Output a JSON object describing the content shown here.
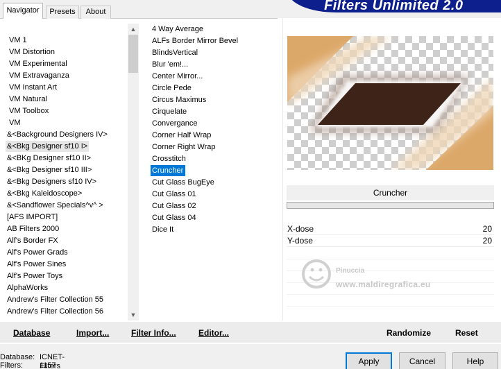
{
  "title": "Filters Unlimited 2.0",
  "tabs": [
    "Navigator",
    "Presets",
    "About"
  ],
  "categories": [
    "VM 1",
    "VM Distortion",
    "VM Experimental",
    "VM Extravaganza",
    "VM Instant Art",
    "VM Natural",
    "VM Toolbox",
    "VM",
    "&<Background Designers IV>",
    "&<Bkg Designer sf10 I>",
    "&<BKg Designer sf10 II>",
    "&<Bkg Designer sf10 III>",
    "&<Bkg Designers sf10 IV>",
    "&<Bkg Kaleidoscope>",
    "&<Sandflower Specials^v^ >",
    "[AFS IMPORT]",
    "AB Filters 2000",
    "Alf's Border FX",
    "Alf's Power Grads",
    "Alf's Power Sines",
    "Alf's Power Toys",
    "AlphaWorks",
    "Andrew's Filter Collection 55",
    "Andrew's Filter Collection 56"
  ],
  "filters": [
    "4 Way Average",
    "ALFs Border Mirror Bevel",
    "BlindsVertical",
    "Blur 'em!...",
    "Center Mirror...",
    "Circle Pede",
    "Circus Maximus",
    "Cirquelate",
    "Convergance",
    "Corner Half Wrap",
    "Corner Right Wrap",
    "Crosstitch",
    "Cruncher",
    "Cut Glass  BugEye",
    "Cut Glass 01",
    "Cut Glass 02",
    "Cut Glass 04",
    "Dice It"
  ],
  "selected_filter": "Cruncher",
  "params": [
    {
      "name": "X-dose",
      "value": "20"
    },
    {
      "name": "Y-dose",
      "value": "20"
    }
  ],
  "buttons": {
    "database": "Database",
    "import": "Import...",
    "filter_info": "Filter Info...",
    "editor": "Editor...",
    "randomize": "Randomize",
    "reset": "Reset",
    "apply": "Apply",
    "cancel": "Cancel",
    "help": "Help"
  },
  "status": {
    "database_label": "Database:",
    "database_value": "ICNET-Filters",
    "filters_label": "Filters:",
    "filters_value": "1157"
  },
  "watermark": {
    "line1": "Pinuccia",
    "line2": "www.maldiregrafica.eu"
  },
  "colors": {
    "banner": "#0c1f8c",
    "selection": "#0078d7",
    "preview_sand": "#dca86a",
    "preview_shape": "#3e2418"
  },
  "icons": {
    "scroll_up": "▲",
    "scroll_down": "▼"
  }
}
